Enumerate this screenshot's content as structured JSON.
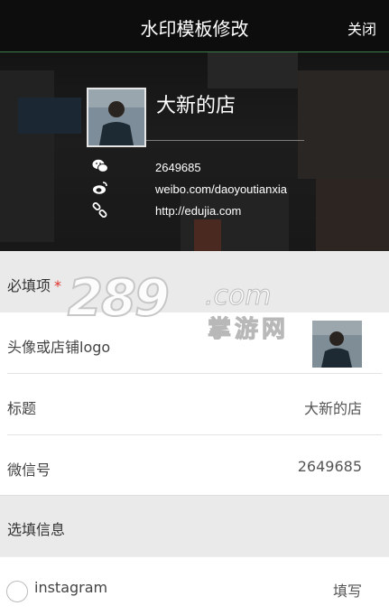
{
  "topbar": {
    "title": "水印模板修改",
    "close_label": "关闭"
  },
  "hero": {
    "store_name": "大新的店",
    "wechat": "2649685",
    "weibo": "weibo.com/daoyoutianxia",
    "link": "http://edujia.com",
    "icons": [
      "wechat-icon",
      "weibo-icon",
      "link-icon"
    ]
  },
  "required_section": {
    "title": "必填项",
    "star": "*"
  },
  "fields": {
    "avatar_label": "头像或店铺logo",
    "title_label": "标题",
    "title_value": "大新的店",
    "wechat_label": "微信号",
    "wechat_value": "2649685"
  },
  "optional_section": {
    "title": "选填信息"
  },
  "optional_fields": {
    "instagram_label": "instagram",
    "instagram_action": "填写"
  },
  "watermark": {
    "main": "289",
    "com": ".com",
    "sub": "掌游网"
  },
  "colors": {
    "accent_line": "#3e7a4a",
    "required_star": "#e0302a"
  }
}
